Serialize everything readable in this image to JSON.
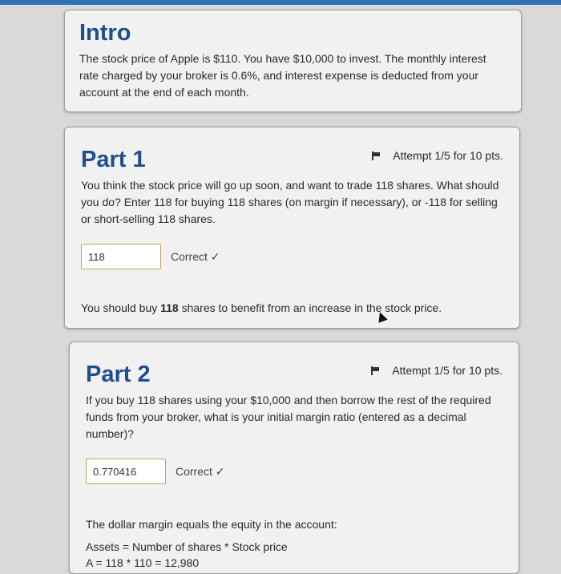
{
  "intro": {
    "title": "Intro",
    "text": "The stock price of Apple is $110. You have $10,000 to invest. The monthly interest rate charged by your broker is 0.6%, and interest expense is deducted from your account at the end of each month."
  },
  "part1": {
    "title": "Part 1",
    "attempt": "Attempt 1/5 for 10 pts.",
    "question": "You think the stock price will go up soon, and want to trade 118 shares. What should you do? Enter 118 for buying 118 shares (on margin if necessary), or -118 for selling or short-selling 118 shares.",
    "answer_value": "118",
    "status": "Correct",
    "status_mark": "✓",
    "feedback_pre": "You should buy ",
    "feedback_bold": "118",
    "feedback_post": " shares to benefit from an increase in the stock price."
  },
  "part2": {
    "title": "Part 2",
    "attempt": "Attempt 1/5 for 10 pts.",
    "question": "If you buy 118 shares using your $10,000 and then borrow the rest of the required funds from your broker, what is your initial margin ratio (entered as a decimal number)?",
    "answer_value": "0.770416",
    "status": "Correct",
    "status_mark": "✓",
    "explanation": "The dollar margin equals the equity in the account:",
    "formula_1": "Assets = Number of shares * Stock price",
    "formula_2": "A = 118 * 110 = 12,980"
  }
}
